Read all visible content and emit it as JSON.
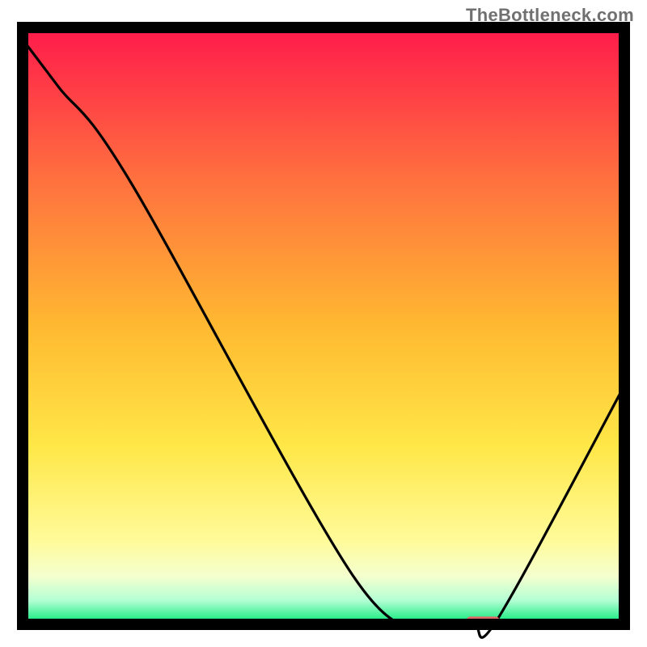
{
  "watermark": "TheBottleneck.com",
  "chart_data": {
    "type": "line",
    "title": "",
    "xlabel": "",
    "ylabel": "",
    "xlim": [
      0,
      100
    ],
    "ylim": [
      0,
      100
    ],
    "background": {
      "type": "vertical-gradient",
      "stops": [
        {
          "pos": 0.0,
          "color": "#ff1a4b"
        },
        {
          "pos": 0.25,
          "color": "#ff6f3f"
        },
        {
          "pos": 0.5,
          "color": "#ffb931"
        },
        {
          "pos": 0.7,
          "color": "#ffe747"
        },
        {
          "pos": 0.86,
          "color": "#fffb9a"
        },
        {
          "pos": 0.92,
          "color": "#f4ffcf"
        },
        {
          "pos": 0.96,
          "color": "#b3ffd4"
        },
        {
          "pos": 1.0,
          "color": "#00e673"
        }
      ]
    },
    "series": [
      {
        "name": "bottleneck-curve",
        "color": "#000000",
        "x": [
          0,
          6,
          18,
          55,
          68,
          70,
          75,
          79,
          100
        ],
        "values": [
          98,
          90,
          74,
          8,
          0,
          0,
          0,
          1,
          40
        ]
      }
    ],
    "marker": {
      "name": "target-marker",
      "color": "#e06a6a",
      "x_pct": 76.5,
      "y_pct": 0,
      "width_pct": 5.5,
      "height_pct": 1.3
    },
    "frame_color": "#000000"
  }
}
